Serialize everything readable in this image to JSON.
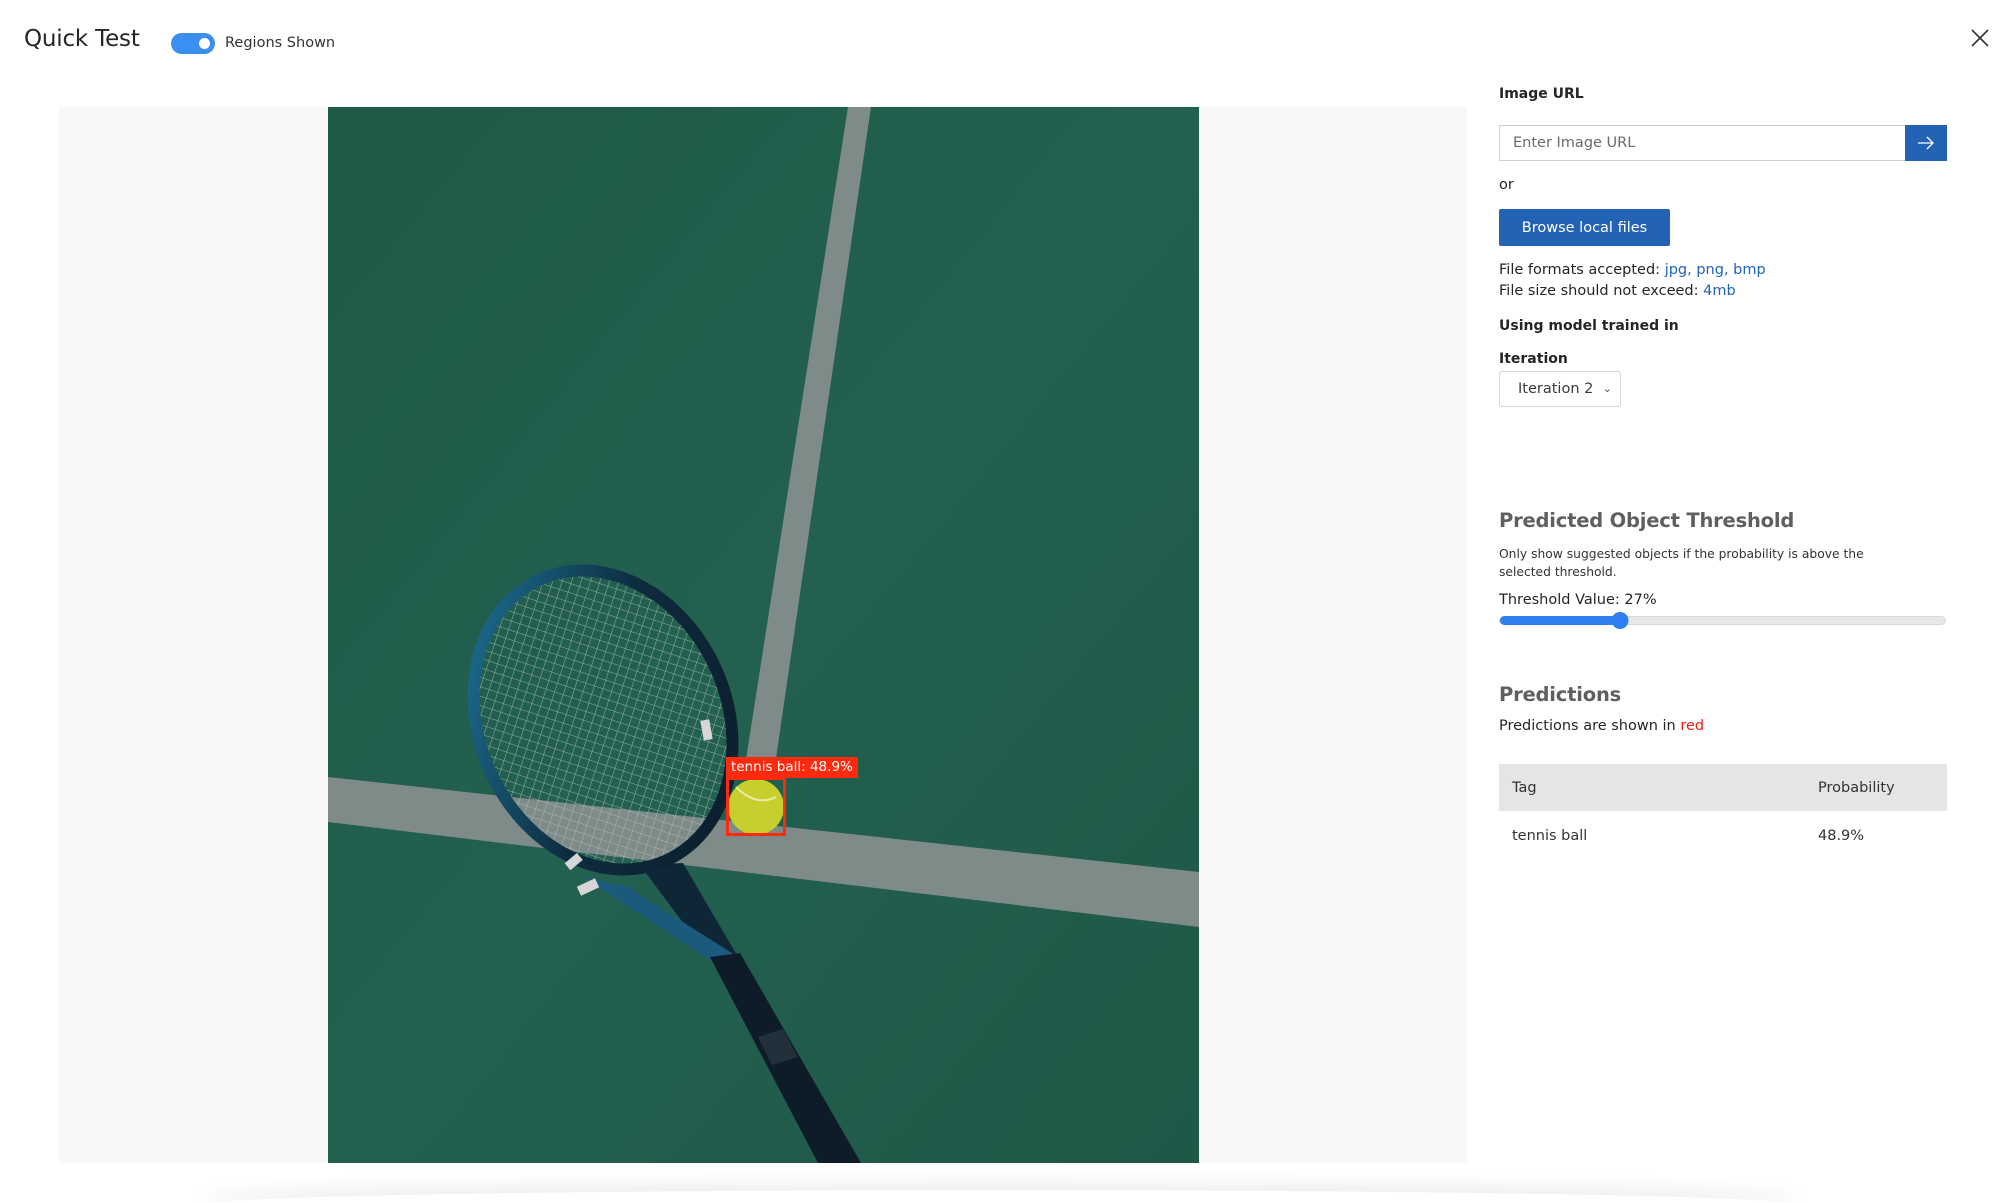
{
  "header": {
    "title": "Quick Test",
    "regions_toggle": {
      "label": "Regions Shown",
      "on": true
    },
    "close_icon": "close-icon"
  },
  "image_view": {
    "detection": {
      "tag": "tennis ball",
      "probability": "48.9%",
      "label": "tennis ball: 48.9%",
      "color": "#ff2a0e"
    }
  },
  "sidebar": {
    "image_url": {
      "label": "Image URL",
      "placeholder": "Enter Image URL",
      "value": "",
      "submit_icon": "arrow-right-icon"
    },
    "or_text": "or",
    "browse_label": "Browse local files",
    "formats": {
      "prefix": "File formats accepted: ",
      "value": "jpg, png, bmp"
    },
    "size": {
      "prefix": "File size should not exceed: ",
      "value": "4mb"
    },
    "model_heading": "Using model trained in",
    "iteration": {
      "label": "Iteration",
      "selected": "Iteration 2"
    },
    "threshold": {
      "heading": "Predicted Object Threshold",
      "description": "Only show suggested objects if the probability is above the selected threshold.",
      "value_label": "Threshold Value: 27%",
      "value_percent": 27
    },
    "predictions": {
      "heading": "Predictions",
      "subtitle_prefix": "Predictions are shown in ",
      "subtitle_color_word": "red",
      "columns": [
        "Tag",
        "Probability"
      ],
      "rows": [
        {
          "tag": "tennis ball",
          "probability": "48.9%"
        }
      ]
    }
  },
  "colors": {
    "primary": "#2263b6",
    "toggle": "#3b8ff0",
    "slider": "#2f7ff0",
    "prediction": "#ff2a0e"
  }
}
